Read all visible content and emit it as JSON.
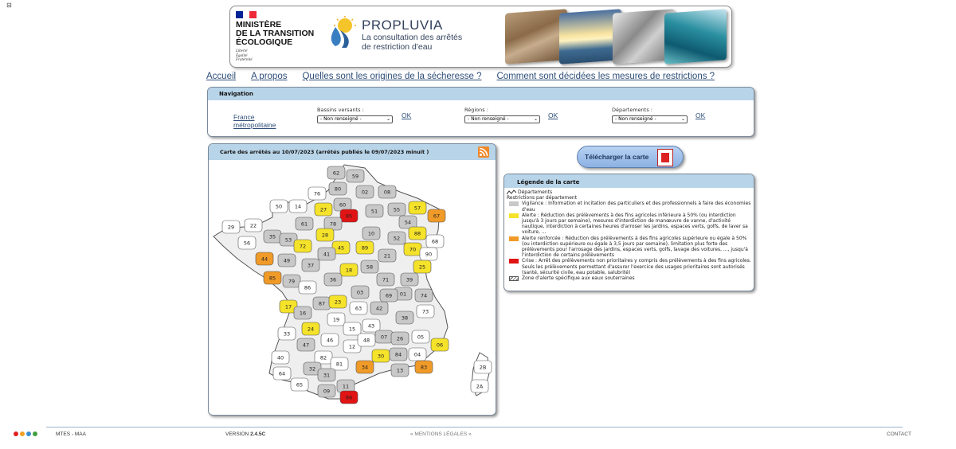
{
  "corner_icon": "window-icon",
  "banner": {
    "flag_colors": [
      "#002395",
      "#ffffff",
      "#ed2939"
    ],
    "ministry_lines": [
      "MINISTÈRE",
      "DE LA TRANSITION",
      "ÉCOLOGIQUE"
    ],
    "motto_lines": [
      "Liberté",
      "Égalité",
      "Fraternité"
    ],
    "brand_title": "PROPLUVIA",
    "brand_subtitle_lines": [
      "La consultation des arrêtés",
      "de restriction d'eau"
    ]
  },
  "top_menu": [
    {
      "label": "Accueil"
    },
    {
      "label": "A propos"
    },
    {
      "label": "Quelles sont les origines de la sécheresse ?"
    },
    {
      "label": "Comment sont décidées les mesures de restrictions ?"
    }
  ],
  "navigation": {
    "title": "Navigation",
    "home_link_lines": [
      "France",
      "métropolitaine"
    ],
    "groups": [
      {
        "label": "Bassins versants :",
        "value": "- Non renseigné -",
        "ok": "OK"
      },
      {
        "label": "Régions :",
        "value": "- Non renseigné -",
        "ok": "OK"
      },
      {
        "label": "Départements :",
        "value": "- Non renseigné -",
        "ok": "OK"
      }
    ]
  },
  "map": {
    "title": "Carte des arrêtés au 10/07/2023 (arrêtés publiés le 09/07/2023 minuit )",
    "rss_icon": "rss-icon",
    "colors": {
      "grey": "#c8c8c8",
      "yellow": "#f5e22a",
      "orange": "#f09a28",
      "red": "#e01414",
      "white": "#ffffff"
    },
    "departments": [
      {
        "code": "62",
        "status": "grey"
      },
      {
        "code": "59",
        "status": "grey"
      },
      {
        "code": "80",
        "status": "grey"
      },
      {
        "code": "02",
        "status": "grey"
      },
      {
        "code": "08",
        "status": "grey"
      },
      {
        "code": "76",
        "status": "white"
      },
      {
        "code": "60",
        "status": "grey"
      },
      {
        "code": "95",
        "status": "red"
      },
      {
        "code": "55",
        "status": "grey"
      },
      {
        "code": "57",
        "status": "yellow"
      },
      {
        "code": "67",
        "status": "orange"
      },
      {
        "code": "14",
        "status": "white"
      },
      {
        "code": "50",
        "status": "white"
      },
      {
        "code": "27",
        "status": "yellow"
      },
      {
        "code": "78",
        "status": "grey"
      },
      {
        "code": "51",
        "status": "grey"
      },
      {
        "code": "54",
        "status": "grey"
      },
      {
        "code": "88",
        "status": "yellow"
      },
      {
        "code": "68",
        "status": "white"
      },
      {
        "code": "29",
        "status": "white"
      },
      {
        "code": "22",
        "status": "white"
      },
      {
        "code": "35",
        "status": "grey"
      },
      {
        "code": "61",
        "status": "grey"
      },
      {
        "code": "28",
        "status": "yellow"
      },
      {
        "code": "10",
        "status": "grey"
      },
      {
        "code": "52",
        "status": "grey"
      },
      {
        "code": "56",
        "status": "white"
      },
      {
        "code": "53",
        "status": "grey"
      },
      {
        "code": "72",
        "status": "yellow"
      },
      {
        "code": "45",
        "status": "yellow"
      },
      {
        "code": "89",
        "status": "yellow"
      },
      {
        "code": "21",
        "status": "grey"
      },
      {
        "code": "70",
        "status": "yellow"
      },
      {
        "code": "90",
        "status": "white"
      },
      {
        "code": "44",
        "status": "orange"
      },
      {
        "code": "49",
        "status": "grey"
      },
      {
        "code": "37",
        "status": "grey"
      },
      {
        "code": "41",
        "status": "grey"
      },
      {
        "code": "18",
        "status": "yellow"
      },
      {
        "code": "58",
        "status": "grey"
      },
      {
        "code": "25",
        "status": "yellow"
      },
      {
        "code": "39",
        "status": "grey"
      },
      {
        "code": "85",
        "status": "orange"
      },
      {
        "code": "79",
        "status": "grey"
      },
      {
        "code": "86",
        "status": "white"
      },
      {
        "code": "36",
        "status": "grey"
      },
      {
        "code": "03",
        "status": "grey"
      },
      {
        "code": "71",
        "status": "grey"
      },
      {
        "code": "01",
        "status": "grey"
      },
      {
        "code": "17",
        "status": "yellow"
      },
      {
        "code": "16",
        "status": "grey"
      },
      {
        "code": "87",
        "status": "grey"
      },
      {
        "code": "23",
        "status": "yellow"
      },
      {
        "code": "63",
        "status": "white"
      },
      {
        "code": "42",
        "status": "grey"
      },
      {
        "code": "69",
        "status": "grey"
      },
      {
        "code": "74",
        "status": "grey"
      },
      {
        "code": "73",
        "status": "white"
      },
      {
        "code": "24",
        "status": "yellow"
      },
      {
        "code": "19",
        "status": "white"
      },
      {
        "code": "15",
        "status": "white"
      },
      {
        "code": "43",
        "status": "white"
      },
      {
        "code": "38",
        "status": "grey"
      },
      {
        "code": "33",
        "status": "white"
      },
      {
        "code": "46",
        "status": "white"
      },
      {
        "code": "12",
        "status": "white"
      },
      {
        "code": "48",
        "status": "white"
      },
      {
        "code": "07",
        "status": "grey"
      },
      {
        "code": "26",
        "status": "grey"
      },
      {
        "code": "05",
        "status": "white"
      },
      {
        "code": "40",
        "status": "white"
      },
      {
        "code": "47",
        "status": "grey"
      },
      {
        "code": "82",
        "status": "white"
      },
      {
        "code": "81",
        "status": "white"
      },
      {
        "code": "30",
        "status": "yellow"
      },
      {
        "code": "84",
        "status": "grey"
      },
      {
        "code": "04",
        "status": "white"
      },
      {
        "code": "06",
        "status": "yellow"
      },
      {
        "code": "32",
        "status": "grey"
      },
      {
        "code": "31",
        "status": "grey"
      },
      {
        "code": "34",
        "status": "orange"
      },
      {
        "code": "13",
        "status": "grey"
      },
      {
        "code": "83",
        "status": "orange"
      },
      {
        "code": "64",
        "status": "white"
      },
      {
        "code": "65",
        "status": "white"
      },
      {
        "code": "09",
        "status": "grey"
      },
      {
        "code": "11",
        "status": "grey"
      },
      {
        "code": "66",
        "status": "red"
      },
      {
        "code": "2B",
        "status": "white"
      },
      {
        "code": "2A",
        "status": "white"
      }
    ]
  },
  "download": {
    "label": "Télécharger la carte",
    "icon": "pdf-icon"
  },
  "legend": {
    "title": "Légende de la carte",
    "departments_label": "Départements",
    "restrictions_label": "Restrictions par département",
    "items": [
      {
        "swatch": "grey",
        "text": "Vigilance : Information et incitation des particuliers et des professionnels à faire des économies d'eau"
      },
      {
        "swatch": "yellow",
        "text": "Alerte : Réduction des prélèvements à des fins agricoles inférieure à 50% (ou interdiction jusqu'à 3 jours par semaine), mesures d'interdiction de manœuvre de vanne, d'activité nautique, interdiction à certaines heures d'arroser les jardins, espaces verts, golfs, de laver sa voiture, ..."
      },
      {
        "swatch": "orange",
        "text": "Alerte renforcée : Réduction des prélèvements à des fins agricoles supérieure ou égale à 50% (ou interdiction supérieure ou égale à 3,5 jours par semaine), limitation plus forte des prélèvements pour l'arrosage des jardins, espaces verts, golfs, lavage des voitures, ..., jusqu'à l'interdiction de certains prélèvements"
      },
      {
        "swatch": "red",
        "text": "Crise : Arrêt des prélèvements non prioritaires y compris des prélèvements à des fins agricoles. Seuls les prélèvements permettant d'assurer l'exercice des usages prioritaires sont autorisés (santé, sécurité civile, eau potable, salubrité)"
      },
      {
        "swatch": "hatch",
        "text": "Zone d'alerte spécifique aux eaux souterraines"
      }
    ]
  },
  "footer": {
    "dot_colors": [
      "#e02020",
      "#f0a020",
      "#3a8fd0",
      "#40a040"
    ],
    "org": "MTES - MAA",
    "version_label": "VERSION",
    "version_value": "2.4.5C",
    "legal": "« MENTIONS LÉGALES »",
    "contact": "CONTACT"
  }
}
